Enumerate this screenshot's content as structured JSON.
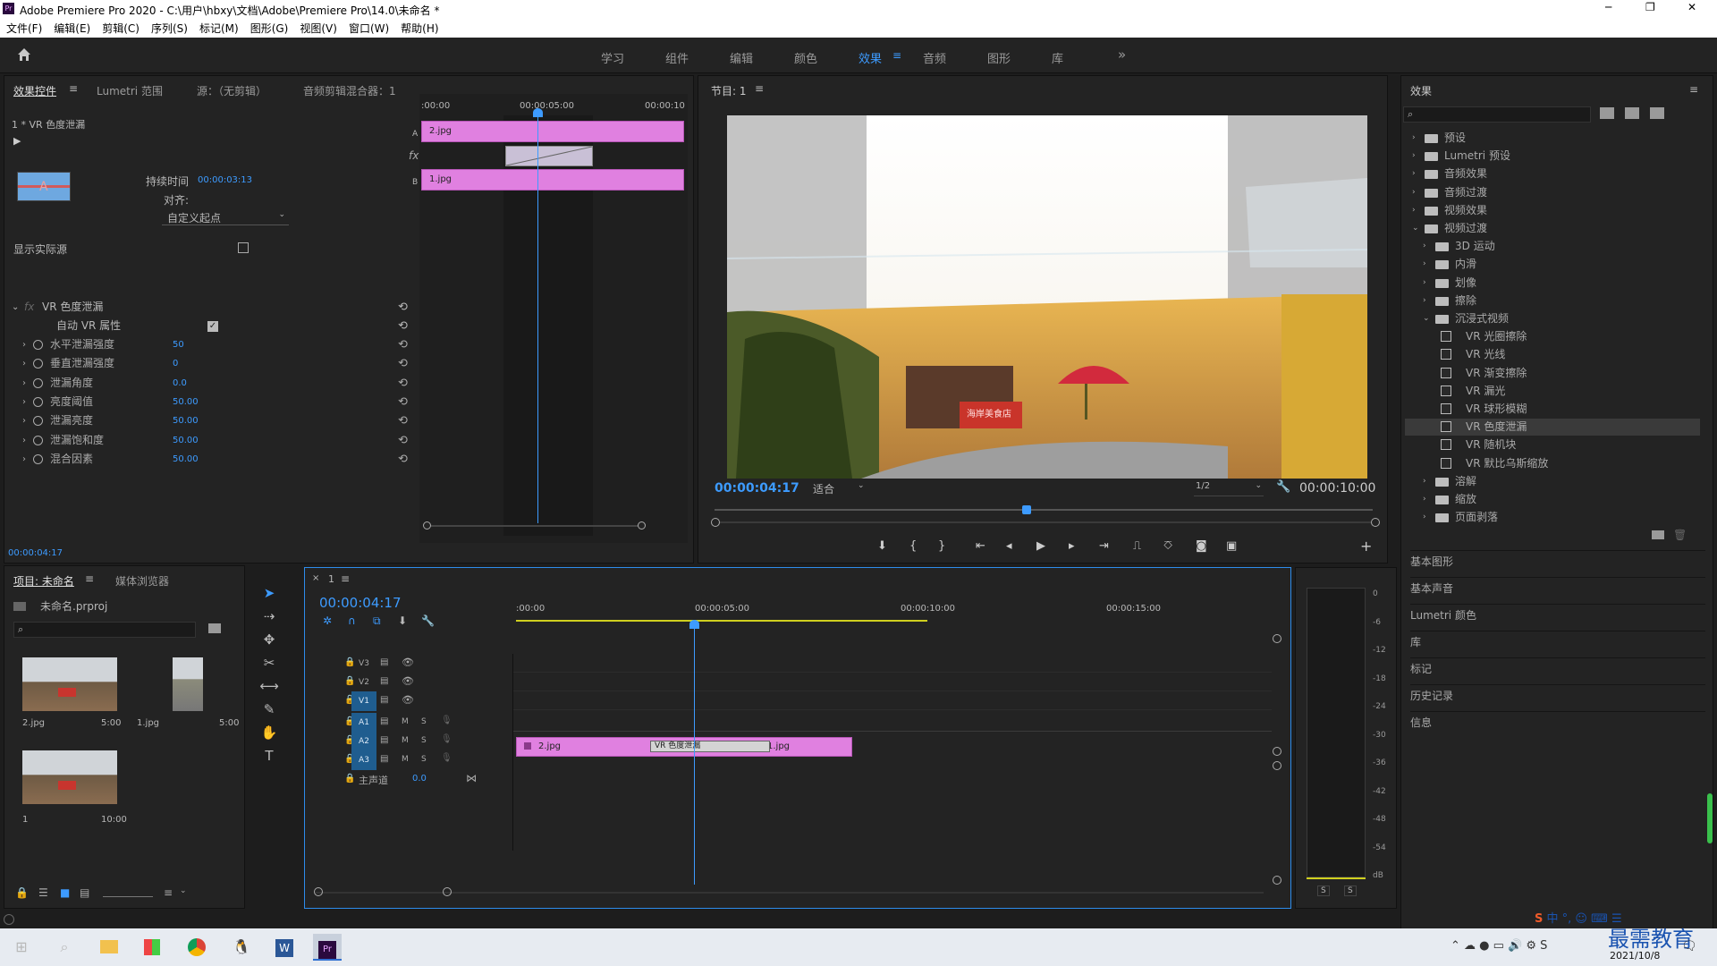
{
  "window": {
    "app_icon": "Pr",
    "title": "Adobe Premiere Pro 2020 - C:\\用户\\hbxy\\文档\\Adobe\\Premiere Pro\\14.0\\未命名 *",
    "controls": [
      "─",
      "❐",
      "✕"
    ]
  },
  "menu": [
    "文件(F)",
    "编辑(E)",
    "剪辑(C)",
    "序列(S)",
    "标记(M)",
    "图形(G)",
    "视图(V)",
    "窗口(W)",
    "帮助(H)"
  ],
  "workspaces": [
    "学习",
    "组件",
    "编辑",
    "颜色",
    "效果",
    "音频",
    "图形",
    "库"
  ],
  "active_workspace": "效果",
  "more_workspaces": "»",
  "effect_controls": {
    "tabs": [
      "效果控件",
      "Lumetri 范围",
      "源：（无剪辑）",
      "音频剪辑混合器：1"
    ],
    "clip_header": "1 * VR 色度泄漏",
    "duration_label": "持续时间",
    "duration_value": "00:00:03:13",
    "align_label": "对齐:",
    "align_value": "自定义起点",
    "show_actual_label": "显示实际源",
    "effect_name": "VR 色度泄漏",
    "auto_vr_label": "自动 VR 属性",
    "properties": [
      {
        "name": "水平泄漏强度",
        "value": "50"
      },
      {
        "name": "垂直泄漏强度",
        "value": "0"
      },
      {
        "name": "泄漏角度",
        "value": "0.0"
      },
      {
        "name": "亮度阈值",
        "value": "50.00"
      },
      {
        "name": "泄漏亮度",
        "value": "50.00"
      },
      {
        "name": "泄漏饱和度",
        "value": "50.00"
      },
      {
        "name": "混合因素",
        "value": "50.00"
      }
    ],
    "timeline_ticks": [
      ":00:00",
      "00:00:05:00",
      "00:00:10"
    ],
    "track_a": "A",
    "track_b": "B",
    "clip_a": "2.jpg",
    "clip_b": "1.jpg",
    "fx_label": "fx",
    "current_time": "00:00:04:17"
  },
  "program": {
    "title": "节目: 1",
    "timecode": "00:00:04:17",
    "fit": "适合",
    "resolution": "1/2",
    "duration": "00:00:10:00",
    "sign_text": "海岸美食店"
  },
  "project": {
    "tabs": [
      "项目: 未命名",
      "媒体浏览器"
    ],
    "file": "未命名.prproj",
    "items": [
      {
        "name": "2.jpg",
        "duration": "5:00"
      },
      {
        "name": "1.jpg",
        "duration": "5:00"
      },
      {
        "name": "1",
        "duration": "10:00"
      }
    ]
  },
  "timeline": {
    "seq_name": "1",
    "timecode": "00:00:04:17",
    "ruler": [
      ":00:00",
      "00:00:05:00",
      "00:00:10:00",
      "00:00:15:00"
    ],
    "video_tracks": [
      "V3",
      "V2",
      "V1"
    ],
    "audio_tracks": [
      "A1",
      "A2",
      "A3"
    ],
    "master_label": "主声道",
    "master_value": "0.0",
    "clips": {
      "clip1": "2.jpg",
      "transition": "VR 色度泄漏",
      "clip2": "1.jpg"
    },
    "m": "M",
    "s": "S"
  },
  "effects": {
    "title": "效果",
    "tree": [
      {
        "label": "预设",
        "level": 0,
        "type": "folder",
        "open": false
      },
      {
        "label": "Lumetri 预设",
        "level": 0,
        "type": "folder",
        "open": false
      },
      {
        "label": "音频效果",
        "level": 0,
        "type": "folder",
        "open": false
      },
      {
        "label": "音频过渡",
        "level": 0,
        "type": "folder",
        "open": false
      },
      {
        "label": "视频效果",
        "level": 0,
        "type": "folder",
        "open": false
      },
      {
        "label": "视频过渡",
        "level": 0,
        "type": "folder",
        "open": true
      },
      {
        "label": "3D 运动",
        "level": 1,
        "type": "folder",
        "open": false
      },
      {
        "label": "内滑",
        "level": 1,
        "type": "folder",
        "open": false
      },
      {
        "label": "划像",
        "level": 1,
        "type": "folder",
        "open": false
      },
      {
        "label": "擦除",
        "level": 1,
        "type": "folder",
        "open": false
      },
      {
        "label": "沉浸式视频",
        "level": 1,
        "type": "folder",
        "open": true
      },
      {
        "label": "VR 光圈擦除",
        "level": 2,
        "type": "fx"
      },
      {
        "label": "VR 光线",
        "level": 2,
        "type": "fx"
      },
      {
        "label": "VR 渐变擦除",
        "level": 2,
        "type": "fx"
      },
      {
        "label": "VR 漏光",
        "level": 2,
        "type": "fx"
      },
      {
        "label": "VR 球形模糊",
        "level": 2,
        "type": "fx"
      },
      {
        "label": "VR 色度泄漏",
        "level": 2,
        "type": "fx",
        "selected": true
      },
      {
        "label": "VR 随机块",
        "level": 2,
        "type": "fx"
      },
      {
        "label": "VR 默比乌斯缩放",
        "level": 2,
        "type": "fx"
      },
      {
        "label": "溶解",
        "level": 1,
        "type": "folder",
        "open": false
      },
      {
        "label": "缩放",
        "level": 1,
        "type": "folder",
        "open": false
      },
      {
        "label": "页面剥落",
        "level": 1,
        "type": "folder",
        "open": false
      }
    ],
    "sections": [
      "基本图形",
      "基本声音",
      "Lumetri 颜色",
      "库",
      "标记",
      "历史记录",
      "信息"
    ]
  },
  "audio_meter": {
    "ticks": [
      "0",
      "-6",
      "-12",
      "-18",
      "-24",
      "-30",
      "-36",
      "-42",
      "-48",
      "-54",
      "dB"
    ],
    "solo": [
      "S",
      "S"
    ]
  },
  "taskbar": {
    "ime": "中",
    "date": "2021/10/8",
    "watermark": "最需教育"
  }
}
